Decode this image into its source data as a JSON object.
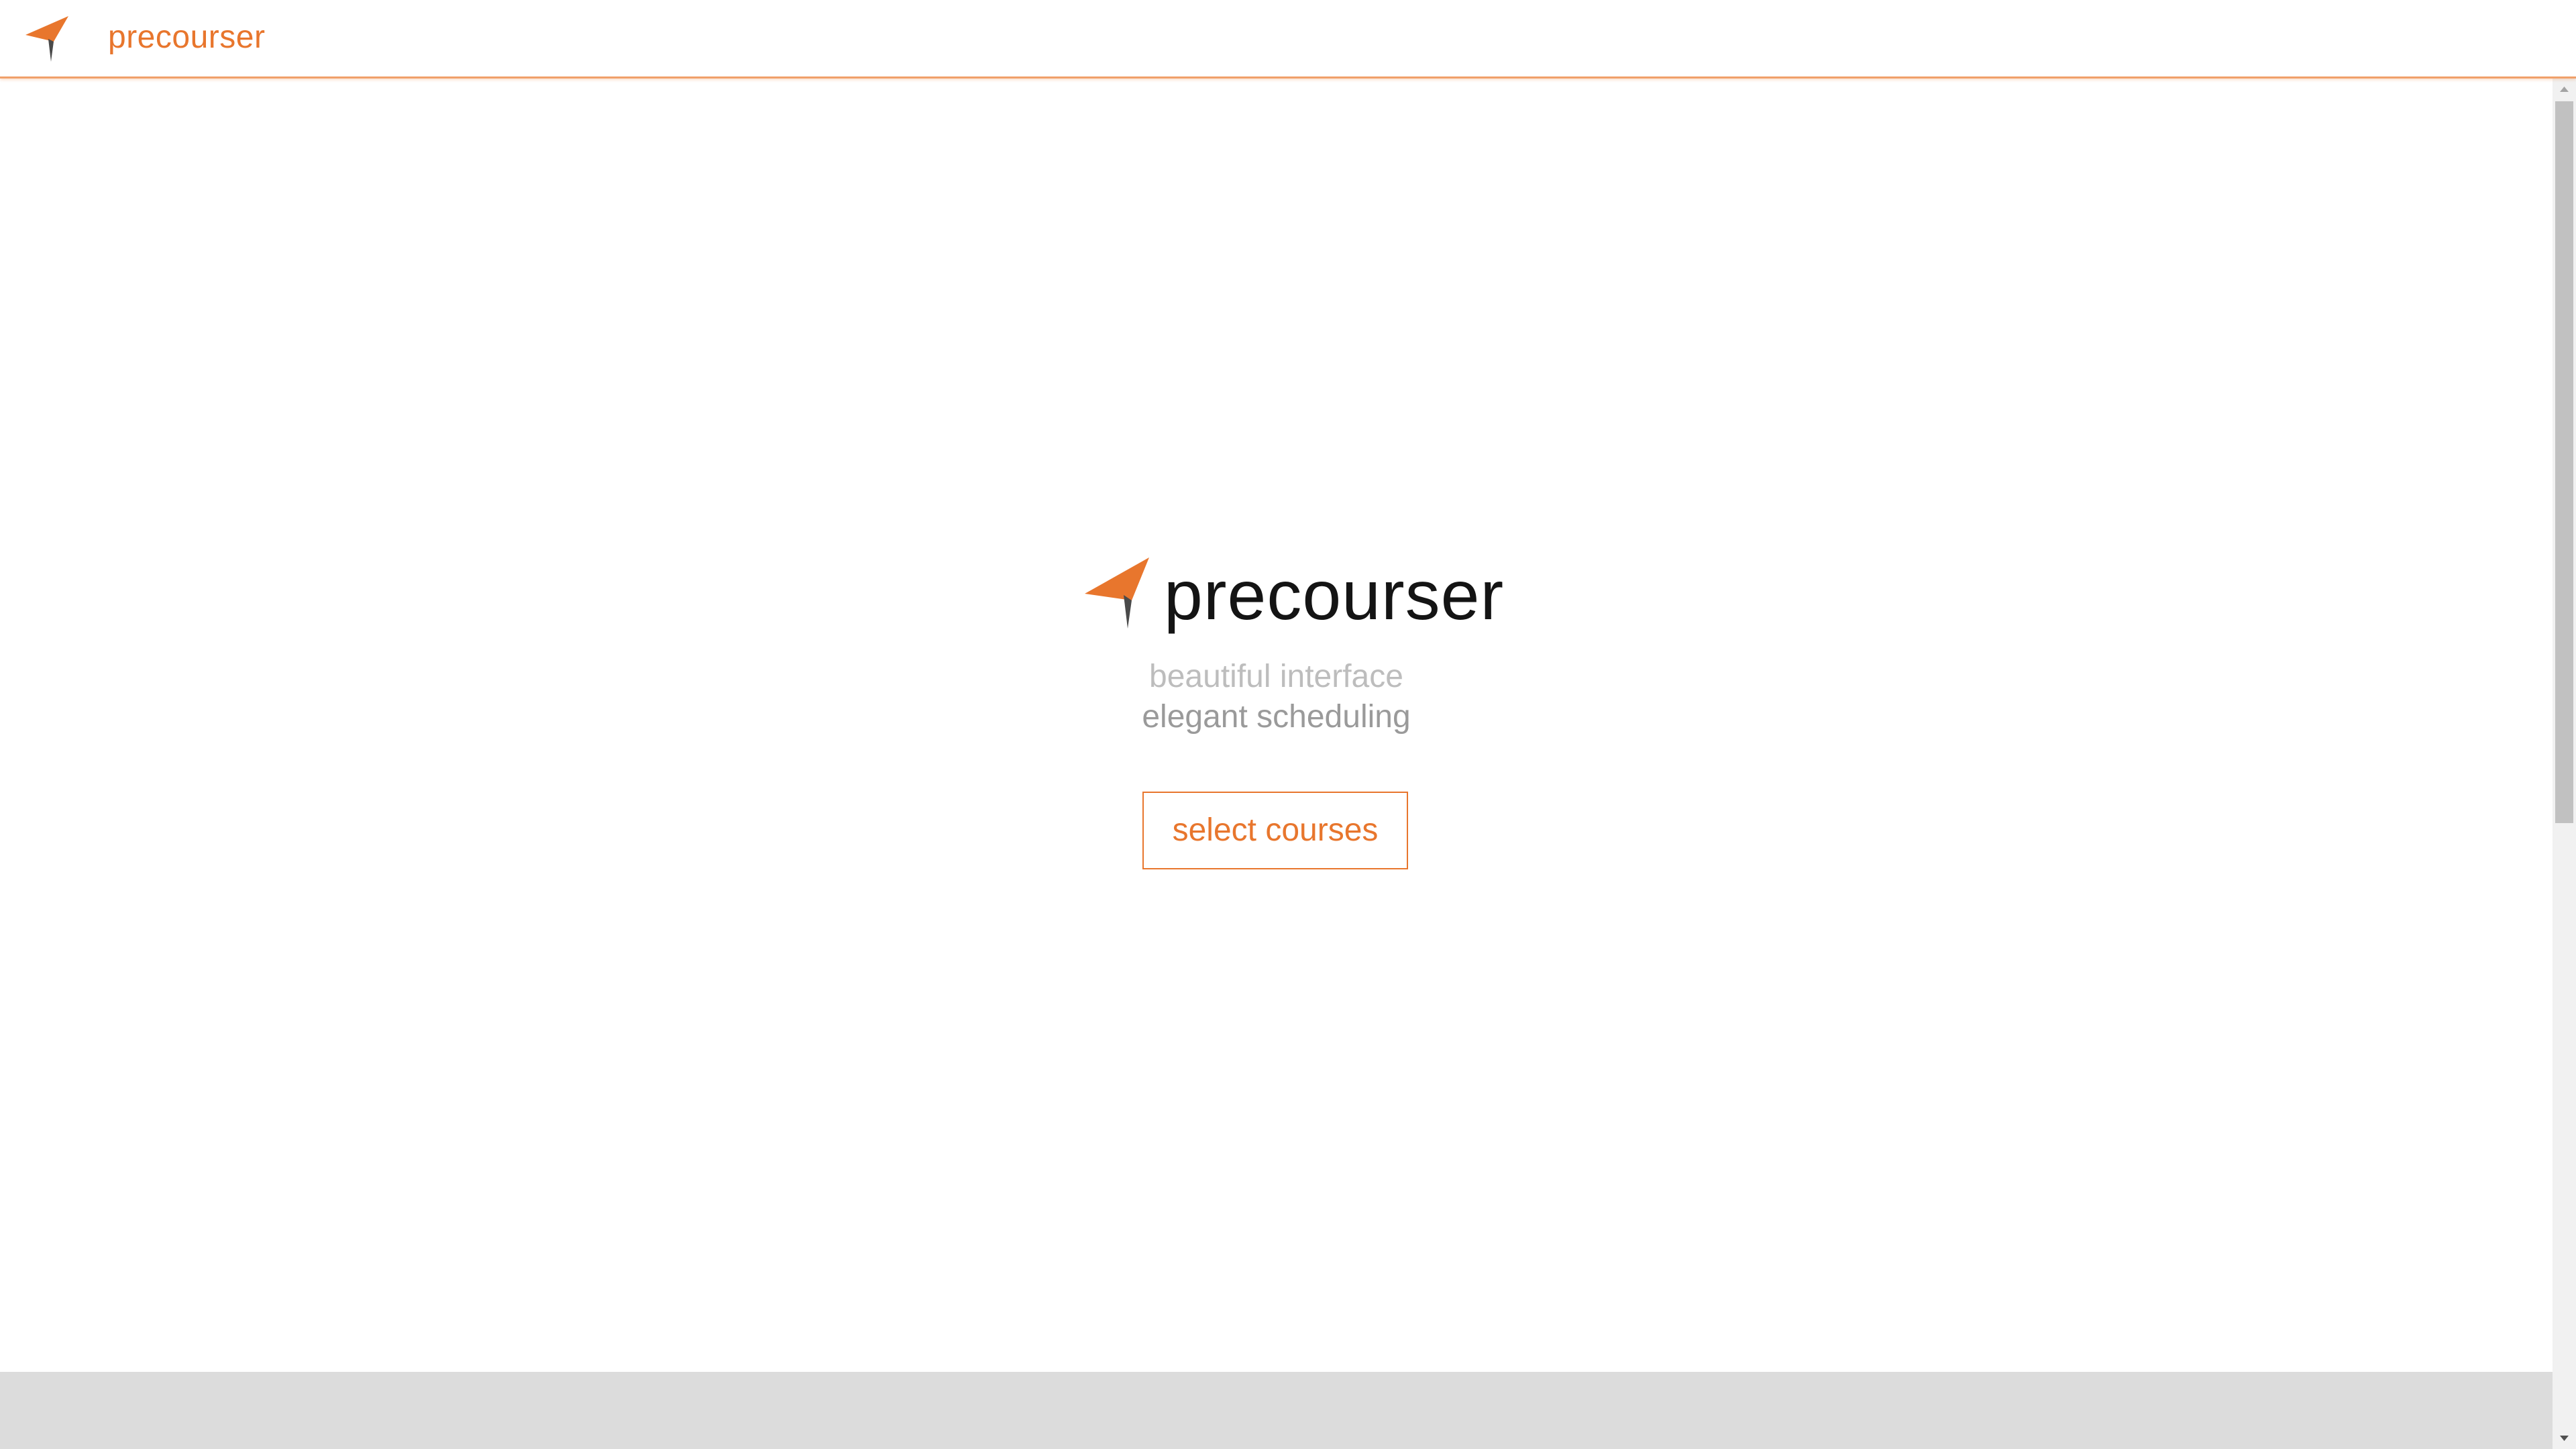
{
  "header": {
    "title": "precourser",
    "logo_icon": "paper-plane-arrow-icon"
  },
  "hero": {
    "title": "precourser",
    "logo_icon": "paper-plane-arrow-icon",
    "tagline_line1": "beautiful interface",
    "tagline_line2": "elegant scheduling",
    "cta_label": "select courses"
  },
  "scrollbar": {
    "position_fraction": 0.0,
    "visible_fraction": 0.55
  },
  "colors": {
    "accent": "#e8762d",
    "logo_dark": "#4a4a4a",
    "title_text": "#141414",
    "tagline_light": "#bdbdbd",
    "tagline_dark": "#9a9a9a",
    "footer_bg": "#dcdcdc"
  }
}
